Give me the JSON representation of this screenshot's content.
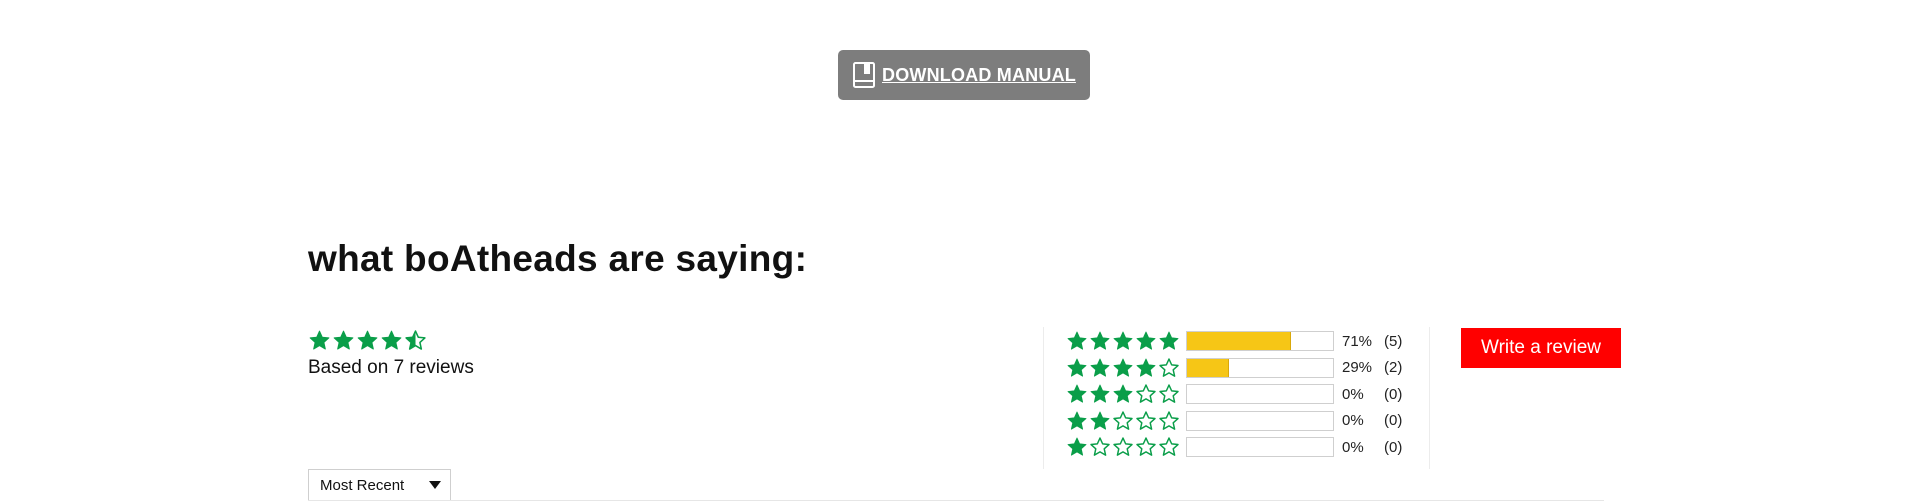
{
  "download": {
    "label": "DOWNLOAD MANUAL",
    "icon": "book-icon"
  },
  "reviews": {
    "title": "what boAtheads are saying:",
    "average_rating": 4.5,
    "max_rating": 5,
    "based_on": "Based on 7 reviews",
    "star_color": "#0a9e49",
    "bar_color": "#f6c616",
    "histogram": [
      {
        "stars": 5,
        "fraction": 0.71,
        "percent_label": "71%",
        "count_label": "(5)"
      },
      {
        "stars": 4,
        "fraction": 0.29,
        "percent_label": "29%",
        "count_label": "(2)"
      },
      {
        "stars": 3,
        "fraction": 0,
        "percent_label": "0%",
        "count_label": "(0)"
      },
      {
        "stars": 2,
        "fraction": 0,
        "percent_label": "0%",
        "count_label": "(0)"
      },
      {
        "stars": 1,
        "fraction": 0,
        "percent_label": "0%",
        "count_label": "(0)"
      }
    ],
    "write_review_label": "Write a review",
    "write_review_color": "#ff0000",
    "sort": {
      "selected": "Most Recent"
    }
  }
}
